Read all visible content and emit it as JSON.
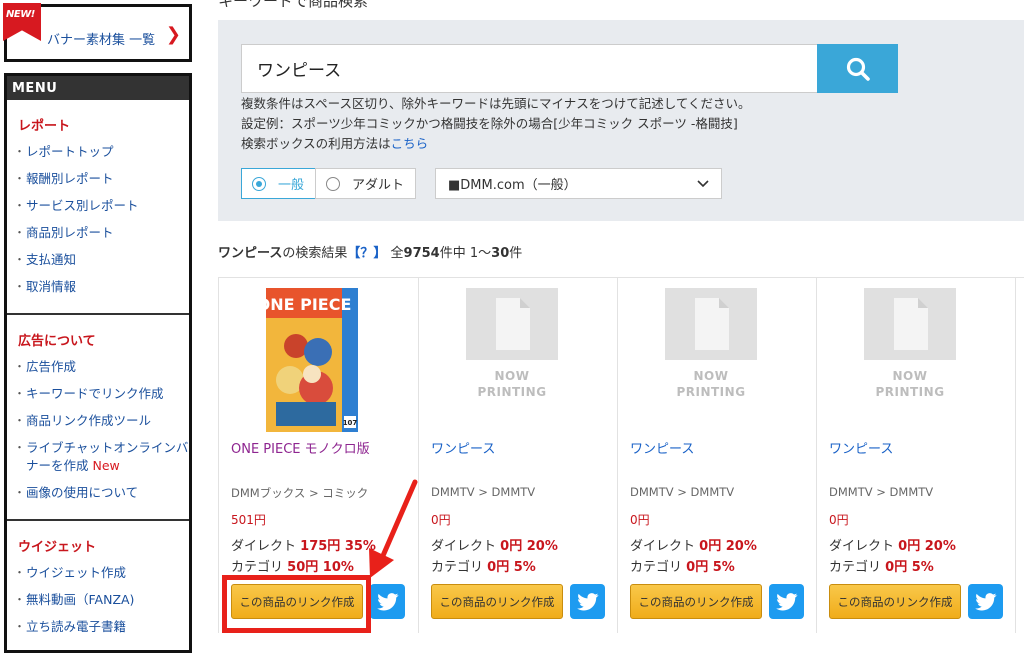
{
  "banner": {
    "new_badge": "NEW!",
    "link_text": "バナー素材集 一覧",
    "chevron": "❯"
  },
  "menu": {
    "header": "MENU",
    "sections": [
      {
        "title": "レポート",
        "items": [
          "レポートトップ",
          "報酬別レポート",
          "サービス別レポート",
          "商品別レポート",
          "支払通知",
          "取消情報"
        ]
      },
      {
        "title": "広告について",
        "items": [
          "広告作成",
          "キーワードでリンク作成",
          "商品リンク作成ツール",
          "ライブチャットオンラインバナーを作成",
          "画像の使用について"
        ],
        "new_label": "New"
      },
      {
        "title": "ウイジェット",
        "items": [
          "ウイジェット作成",
          "無料動画（FANZA)",
          "立ち読み電子書籍"
        ]
      }
    ]
  },
  "page": {
    "partial_title": "キーワードで商品検索"
  },
  "search": {
    "query": "ワンピース",
    "help_line1": "複数条件はスペース区切り、除外キーワードは先頭にマイナスをつけて記述してください。",
    "help_line2": "設定例：スポーツ少年コミックかつ格闘技を除外の場合[少年コミック スポーツ -格闘技]",
    "help_line3_prefix": "検索ボックスの利用方法は",
    "help_line3_link": "こちら",
    "radio_general": "一般",
    "radio_adult": "アダルト",
    "select_value": "■DMM.com（一般）"
  },
  "results": {
    "keyword": "ワンピース",
    "label": "の検索結果",
    "help": "【？】",
    "total_prefix": "全",
    "total": "9754",
    "total_suffix": "件中",
    "range_start": "1〜",
    "range_end": "30",
    "range_suffix": "件"
  },
  "products": [
    {
      "title": "ONE PIECE モノクロ版",
      "category": "DMMブックス > コミック",
      "price": "501円",
      "direct_label": "ダイレクト",
      "direct_value": "175円 35%",
      "category_label": "カテゴリ",
      "category_value": "50円 10%",
      "link_button": "この商品のリンク作成",
      "image": "comic-cover"
    },
    {
      "title": "ワンピース",
      "category": "DMMTV > DMMTV",
      "price": "0円",
      "direct_label": "ダイレクト",
      "direct_value": "0円 20%",
      "category_label": "カテゴリ",
      "category_value": "0円 5%",
      "link_button": "この商品のリンク作成",
      "image": "now-printing"
    },
    {
      "title": "ワンピース",
      "category": "DMMTV > DMMTV",
      "price": "0円",
      "direct_label": "ダイレクト",
      "direct_value": "0円 20%",
      "category_label": "カテゴリ",
      "category_value": "0円 5%",
      "link_button": "この商品のリンク作成",
      "image": "now-printing"
    },
    {
      "title": "ワンピース",
      "category": "DMMTV > DMMTV",
      "price": "0円",
      "direct_label": "ダイレクト",
      "direct_value": "0円 20%",
      "category_label": "カテゴリ",
      "category_value": "0円 5%",
      "link_button": "この商品のリンク作成",
      "image": "now-printing"
    }
  ],
  "now_printing": {
    "line1": "NOW",
    "line2": "PRINTING"
  },
  "colors": {
    "accent": "#3aa7d8",
    "brand_red": "#c8161d",
    "link_blue": "#1a62c7",
    "button_orange": "#f0ac1a",
    "twitter": "#1d9bf0",
    "annotation_red": "#e8211a"
  },
  "icons": {
    "search": "search-icon",
    "twitter": "twitter-icon",
    "select_arrow": "chevron-down-icon"
  }
}
